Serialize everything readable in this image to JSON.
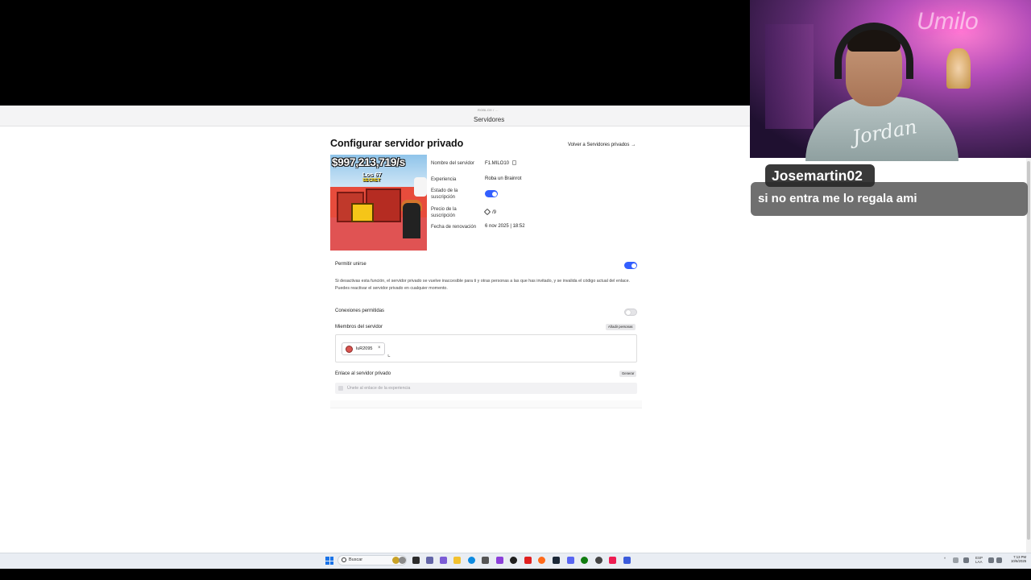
{
  "browser": {
    "crumb": "ROBLOX / ...",
    "page_title": "Servidores"
  },
  "page": {
    "heading": "Configurar servidor privado",
    "back_link": "Volver a Servidores privados",
    "back_arrow": "→",
    "thumbnail": {
      "headline": "$997,213,719/s",
      "subtitle": "Los 67",
      "badge": "SECRET"
    },
    "details": {
      "server_name_label": "Nombre del servidor",
      "server_name_value": "F1.MILO10",
      "experience_label": "Experiencia",
      "experience_value": "Roba un Brainrot",
      "subscription_status_label": "Estado de la suscripción",
      "subscription_status_on": true,
      "subscription_price_label": "Precio de la suscripción",
      "subscription_price_value": "/9",
      "renewal_label": "Fecha de renovación",
      "renewal_value": "6 nov 2025 | 18:52"
    },
    "allow_join": {
      "label": "Permitir unirse",
      "on": true,
      "description": "Si desactivas esta función, el servidor privado se vuelve inaccesible para ti y otras personas a las que has invitado, y se invalida el código actual del enlace. Puedes reactivar el servidor privado en cualquier momento."
    },
    "connections": {
      "label": "Conexiones permitidas",
      "on": false
    },
    "members": {
      "label": "Miembros del servidor",
      "add_button": "Añadir personas",
      "chips": [
        {
          "name": "luR2095",
          "remove": "×"
        }
      ]
    },
    "link": {
      "label": "Enlace al servidor privado",
      "generate_button": "Generar",
      "placeholder": "Únete al enlace de la experiencia"
    }
  },
  "webcam": {
    "neon_sign": "Umilo",
    "shirt_text": "Jordan"
  },
  "chat": {
    "username": "Josemartin02",
    "message": "si no entra me lo regala ami"
  },
  "taskbar": {
    "search_placeholder": "Buscar",
    "language_top": "ESP",
    "language_bottom": "LAA",
    "time": "7:13 PM",
    "date": "10/6/2025"
  },
  "colors": {
    "toggle_on": "#335fff",
    "page_bg": "#ffffff",
    "chat_name_bg": "#282828",
    "chat_msg_bg": "#5f5f5f"
  }
}
